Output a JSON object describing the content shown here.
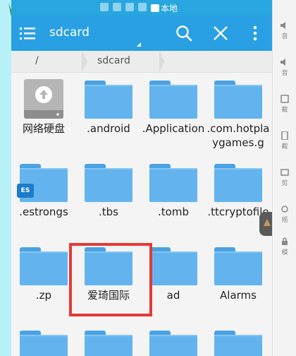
{
  "statusbar": {
    "local_label": "本地"
  },
  "appbar": {
    "title": "sdcard"
  },
  "breadcrumb": {
    "root": "/",
    "current": "sdcard"
  },
  "files": [
    {
      "name": "网络硬盘",
      "type": "netdisk"
    },
    {
      "name": ".android",
      "type": "folder"
    },
    {
      "name": ".Application",
      "type": "folder"
    },
    {
      "name": ".com.hotplaygames.g",
      "type": "folder"
    },
    {
      "name": ".estrongs",
      "type": "folder",
      "badge": "ES"
    },
    {
      "name": ".tbs",
      "type": "folder"
    },
    {
      "name": ".tomb",
      "type": "folder"
    },
    {
      "name": ".ttcryptofile",
      "type": "folder"
    },
    {
      "name": ".zp",
      "type": "folder"
    },
    {
      "name": "爱琦国际",
      "type": "folder",
      "highlighted": true
    },
    {
      "name": "ad",
      "type": "folder"
    },
    {
      "name": "Alarms",
      "type": "folder"
    }
  ],
  "side_panel": {
    "top": "19",
    "items": [
      "音",
      "音",
      "截",
      "截",
      "剪",
      "摇",
      "模"
    ]
  },
  "colors": {
    "appbar": "#2aa0e4",
    "folder": "#63b4ee",
    "highlight": "#e53935"
  }
}
